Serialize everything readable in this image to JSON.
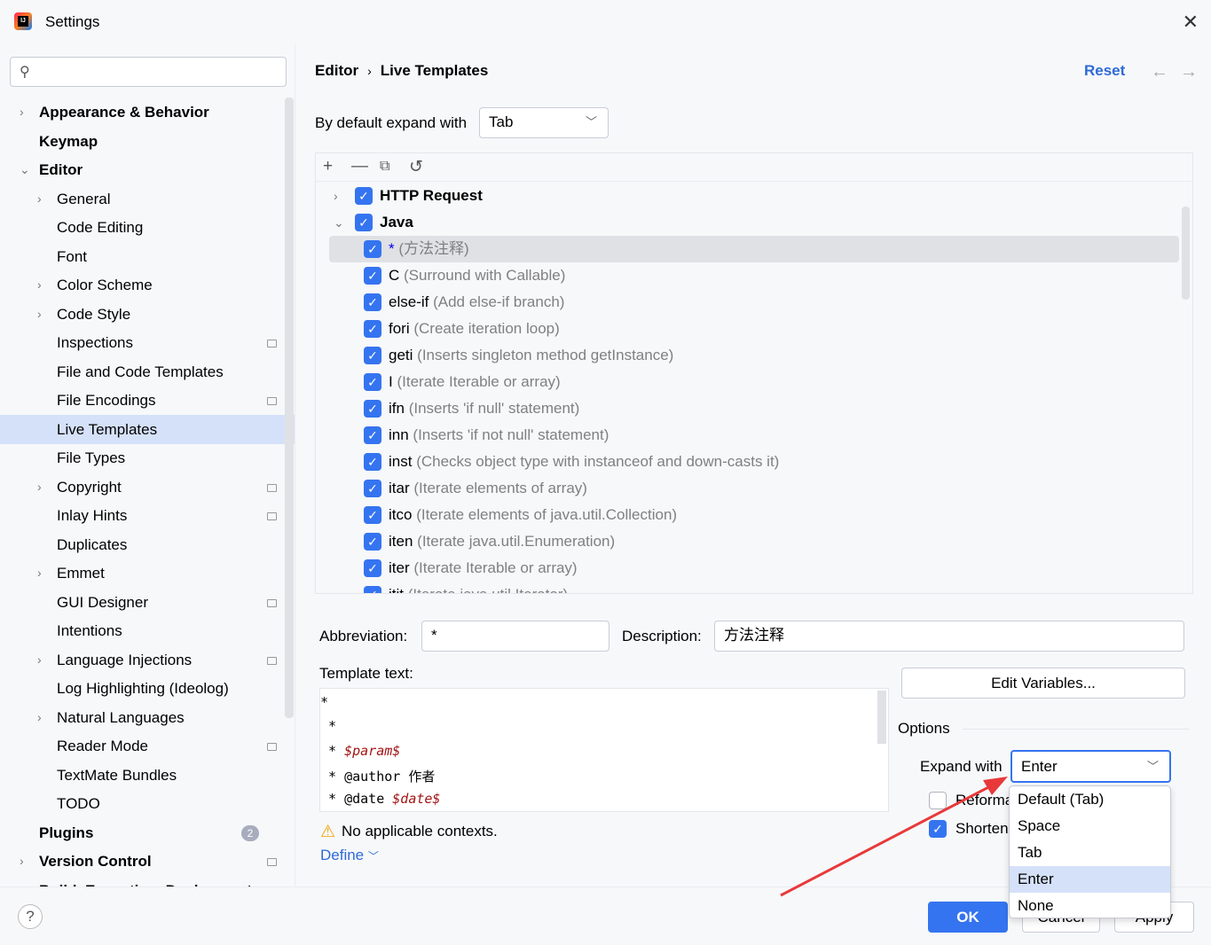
{
  "window": {
    "title": "Settings",
    "close_icon": "close-icon"
  },
  "search": {
    "placeholder": ""
  },
  "sidebar": {
    "items": [
      {
        "label": "Appearance & Behavior",
        "level": 0,
        "bold": true,
        "chevron": "right"
      },
      {
        "label": "Keymap",
        "level": 0,
        "bold": true
      },
      {
        "label": "Editor",
        "level": 0,
        "bold": true,
        "chevron": "down"
      },
      {
        "label": "General",
        "level": 1,
        "chevron": "right"
      },
      {
        "label": "Code Editing",
        "level": 1
      },
      {
        "label": "Font",
        "level": 1
      },
      {
        "label": "Color Scheme",
        "level": 1,
        "chevron": "right"
      },
      {
        "label": "Code Style",
        "level": 1,
        "chevron": "right"
      },
      {
        "label": "Inspections",
        "level": 1,
        "project": true
      },
      {
        "label": "File and Code Templates",
        "level": 1
      },
      {
        "label": "File Encodings",
        "level": 1,
        "project": true
      },
      {
        "label": "Live Templates",
        "level": 1,
        "selected": true
      },
      {
        "label": "File Types",
        "level": 1
      },
      {
        "label": "Copyright",
        "level": 1,
        "chevron": "right",
        "project": true
      },
      {
        "label": "Inlay Hints",
        "level": 1,
        "project": true
      },
      {
        "label": "Duplicates",
        "level": 1
      },
      {
        "label": "Emmet",
        "level": 1,
        "chevron": "right"
      },
      {
        "label": "GUI Designer",
        "level": 1,
        "project": true
      },
      {
        "label": "Intentions",
        "level": 1
      },
      {
        "label": "Language Injections",
        "level": 1,
        "chevron": "right",
        "project": true
      },
      {
        "label": "Log Highlighting (Ideolog)",
        "level": 1
      },
      {
        "label": "Natural Languages",
        "level": 1,
        "chevron": "right"
      },
      {
        "label": "Reader Mode",
        "level": 1,
        "project": true
      },
      {
        "label": "TextMate Bundles",
        "level": 1
      },
      {
        "label": "TODO",
        "level": 1
      },
      {
        "label": "Plugins",
        "level": 0,
        "bold": true,
        "badge": "2"
      },
      {
        "label": "Version Control",
        "level": 0,
        "bold": true,
        "chevron": "right",
        "project": true
      },
      {
        "label": "Build, Execution, Deployment",
        "level": 0,
        "bold": true,
        "chevron": "right"
      }
    ]
  },
  "header": {
    "breadcrumb": [
      "Editor",
      "Live Templates"
    ],
    "reset": "Reset"
  },
  "expand_default": {
    "label": "By default expand with",
    "value": "Tab"
  },
  "templates": {
    "groups": [
      {
        "name": "HTTP Request",
        "checked": true,
        "expanded": false
      },
      {
        "name": "Java",
        "checked": true,
        "expanded": true,
        "items": [
          {
            "abbr": "*",
            "desc": "(方法注释)",
            "checked": true,
            "selected": true
          },
          {
            "abbr": "C",
            "desc": "(Surround with Callable)",
            "checked": true
          },
          {
            "abbr": "else-if",
            "desc": "(Add else-if branch)",
            "checked": true
          },
          {
            "abbr": "fori",
            "desc": "(Create iteration loop)",
            "checked": true
          },
          {
            "abbr": "geti",
            "desc": "(Inserts singleton method getInstance)",
            "checked": true
          },
          {
            "abbr": "I",
            "desc": "(Iterate Iterable or array)",
            "checked": true
          },
          {
            "abbr": "ifn",
            "desc": "(Inserts 'if null' statement)",
            "checked": true
          },
          {
            "abbr": "inn",
            "desc": "(Inserts 'if not null' statement)",
            "checked": true
          },
          {
            "abbr": "inst",
            "desc": "(Checks object type with instanceof and down-casts it)",
            "checked": true
          },
          {
            "abbr": "itar",
            "desc": "(Iterate elements of array)",
            "checked": true
          },
          {
            "abbr": "itco",
            "desc": "(Iterate elements of java.util.Collection)",
            "checked": true
          },
          {
            "abbr": "iten",
            "desc": "(Iterate java.util.Enumeration)",
            "checked": true
          },
          {
            "abbr": "iter",
            "desc": "(Iterate Iterable or array)",
            "checked": true
          },
          {
            "abbr": "itit",
            "desc": "(Iterate java.util.Iterator)",
            "checked": true
          }
        ]
      }
    ]
  },
  "details": {
    "abbreviation_label": "Abbreviation:",
    "abbreviation": "*",
    "description_label": "Description:",
    "description": "方法注释",
    "template_text_label": "Template text:",
    "template_lines": [
      [
        {
          "t": "*"
        }
      ],
      [
        {
          "t": " *"
        }
      ],
      [
        {
          "t": " * "
        },
        {
          "t": "$param$",
          "var": true
        }
      ],
      [
        {
          "t": " * @author 作者"
        }
      ],
      [
        {
          "t": " * @date "
        },
        {
          "t": "$date$",
          "var": true
        }
      ]
    ],
    "edit_variables": "Edit Variables...",
    "options_label": "Options",
    "expand_with_label": "Expand with",
    "expand_with_value": "Enter",
    "reformat_label": "Reformat according to style",
    "reformat_checked": false,
    "shorten_label": "Shorten FQ names",
    "shorten_checked": true,
    "warning": "No applicable contexts.",
    "define": "Define"
  },
  "dropdown": {
    "options": [
      "Default (Tab)",
      "Space",
      "Tab",
      "Enter",
      "None"
    ],
    "selected": "Enter"
  },
  "footer": {
    "ok": "OK",
    "cancel": "Cancel",
    "apply": "Apply",
    "help": "?"
  },
  "colors": {
    "accent": "#3574f0",
    "selection": "#d5e1f9",
    "link": "#2f6ad6",
    "annotation_arrow": "#e8393a"
  }
}
